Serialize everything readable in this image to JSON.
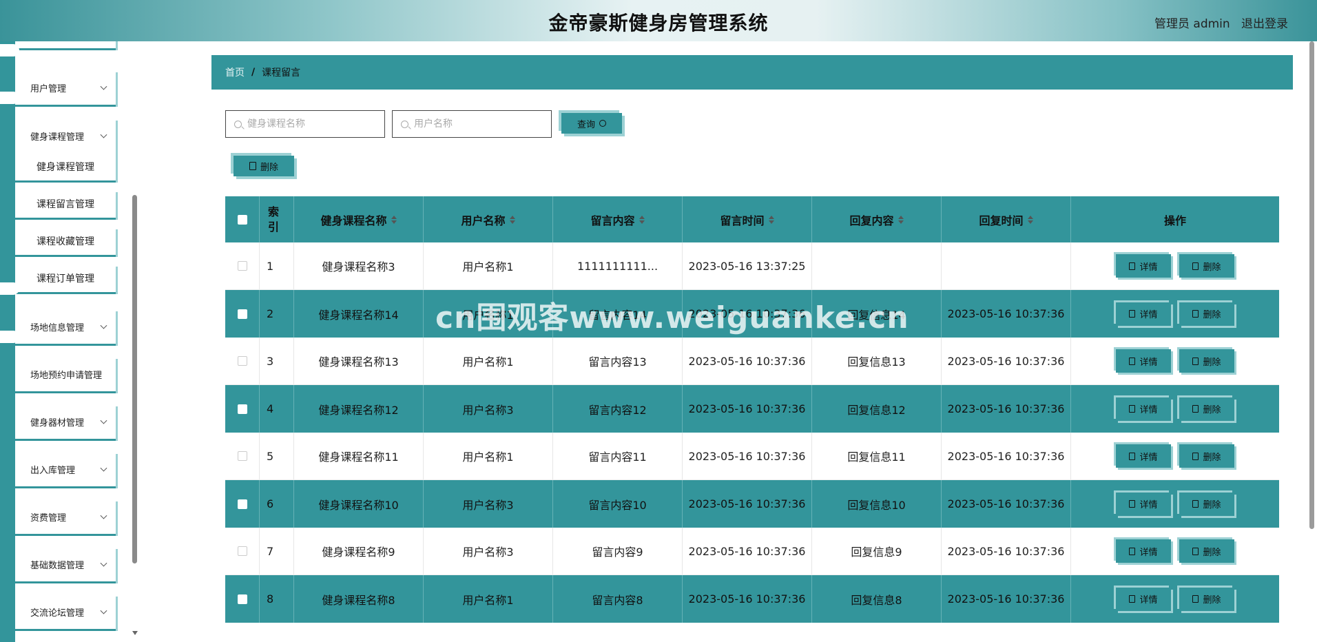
{
  "header": {
    "title": "金帝豪斯健身房管理系统",
    "user": "管理员 admin",
    "logout": "退出登录"
  },
  "sidebar": {
    "items": [
      {
        "label": "用户管理",
        "type": "menu"
      },
      {
        "label": "健身课程管理",
        "type": "menu"
      },
      {
        "label": "健身课程管理",
        "type": "sub"
      },
      {
        "label": "课程留言管理",
        "type": "sub"
      },
      {
        "label": "课程收藏管理",
        "type": "sub"
      },
      {
        "label": "课程订单管理",
        "type": "sub"
      },
      {
        "label": "场地信息管理",
        "type": "menu"
      },
      {
        "label": "场地预约申请管理",
        "type": "menu"
      },
      {
        "label": "健身器材管理",
        "type": "menu"
      },
      {
        "label": "出入库管理",
        "type": "menu"
      },
      {
        "label": "资费管理",
        "type": "menu"
      },
      {
        "label": "基础数据管理",
        "type": "menu"
      },
      {
        "label": "交流论坛管理",
        "type": "menu"
      }
    ]
  },
  "breadcrumb": {
    "home": "首页",
    "separator": "/",
    "current": "课程留言"
  },
  "search": {
    "course_placeholder": "健身课程名称",
    "user_placeholder": "用户名称",
    "query_label": "查询"
  },
  "toolbar": {
    "delete_label": "删除"
  },
  "table": {
    "headers": {
      "index": "索引",
      "course": "健身课程名称",
      "user": "用户名称",
      "content": "留言内容",
      "time": "留言时间",
      "reply": "回复内容",
      "reply_time": "回复时间",
      "ops": "操作"
    },
    "detail_label": "详情",
    "delete_label": "删除",
    "rows": [
      {
        "index": "1",
        "course": "健身课程名称3",
        "user": "用户名称1",
        "content": "1111111111...",
        "time": "2023-05-16 13:37:25",
        "reply": "",
        "reply_time": ""
      },
      {
        "index": "2",
        "course": "健身课程名称14",
        "user": "用户名称1",
        "content": "留言内容14",
        "time": "2023-05-16 10:37:36",
        "reply": "回复信息14",
        "reply_time": "2023-05-16 10:37:36"
      },
      {
        "index": "3",
        "course": "健身课程名称13",
        "user": "用户名称1",
        "content": "留言内容13",
        "time": "2023-05-16 10:37:36",
        "reply": "回复信息13",
        "reply_time": "2023-05-16 10:37:36"
      },
      {
        "index": "4",
        "course": "健身课程名称12",
        "user": "用户名称3",
        "content": "留言内容12",
        "time": "2023-05-16 10:37:36",
        "reply": "回复信息12",
        "reply_time": "2023-05-16 10:37:36"
      },
      {
        "index": "5",
        "course": "健身课程名称11",
        "user": "用户名称1",
        "content": "留言内容11",
        "time": "2023-05-16 10:37:36",
        "reply": "回复信息11",
        "reply_time": "2023-05-16 10:37:36"
      },
      {
        "index": "6",
        "course": "健身课程名称10",
        "user": "用户名称3",
        "content": "留言内容10",
        "time": "2023-05-16 10:37:36",
        "reply": "回复信息10",
        "reply_time": "2023-05-16 10:37:36"
      },
      {
        "index": "7",
        "course": "健身课程名称9",
        "user": "用户名称3",
        "content": "留言内容9",
        "time": "2023-05-16 10:37:36",
        "reply": "回复信息9",
        "reply_time": "2023-05-16 10:37:36"
      },
      {
        "index": "8",
        "course": "健身课程名称8",
        "user": "用户名称1",
        "content": "留言内容8",
        "time": "2023-05-16 10:37:36",
        "reply": "回复信息8",
        "reply_time": "2023-05-16 10:37:36"
      }
    ]
  },
  "watermark": "cn围观客www.weiguanke.cn",
  "colors": {
    "accent": "#33959b",
    "accent_light": "#9dd1d4"
  }
}
